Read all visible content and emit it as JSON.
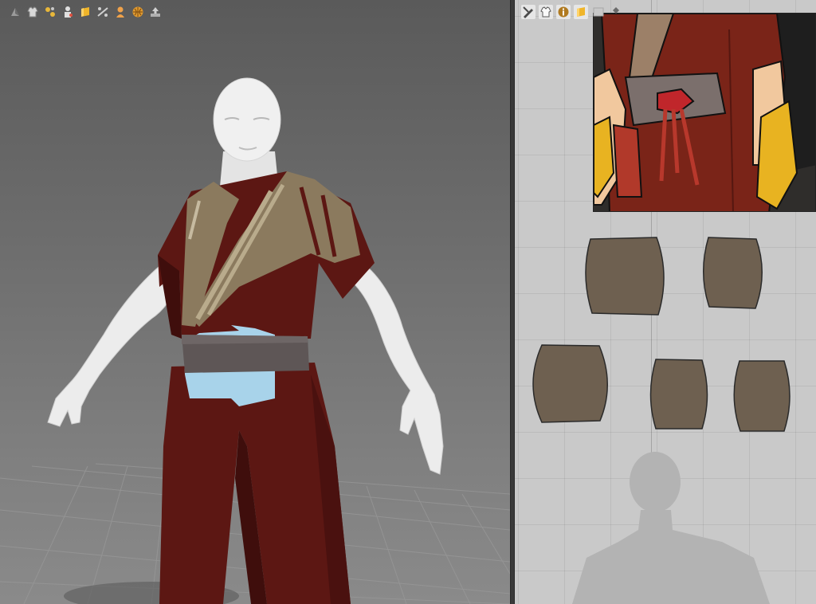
{
  "viewport_toolbar": {
    "buttons": [
      {
        "icon": "avatar-display-icon",
        "color": "#9a9a9a"
      },
      {
        "icon": "garment-display-icon",
        "color": "#d8d8d8"
      },
      {
        "icon": "pins-display-icon",
        "color": "#e8b73a"
      },
      {
        "icon": "avatar-pose-icon",
        "color": "#e0e0e0"
      },
      {
        "icon": "texture-display-icon",
        "color": "#f0b52a"
      },
      {
        "icon": "arrangement-points-icon",
        "color": "#cfcfcf"
      },
      {
        "icon": "skin-display-icon",
        "color": "#f0a24a"
      },
      {
        "icon": "fabric-grid-icon",
        "color": "#e09a30"
      },
      {
        "icon": "export-icon",
        "color": "#b0b0b0"
      }
    ]
  },
  "pattern_toolbar": {
    "buttons": [
      {
        "icon": "edit-pattern-icon",
        "color": "#4a4a4a"
      },
      {
        "icon": "garment-view-icon",
        "color": "#5a5a5a"
      },
      {
        "icon": "info-icon",
        "color": "#b07a20"
      },
      {
        "icon": "texture-view-icon",
        "color": "#f0b52a"
      },
      {
        "icon": "image-view-icon",
        "color": "#a8a8a8"
      },
      {
        "icon": "pin-view-icon",
        "color": "#6a6a6a"
      }
    ]
  },
  "colors": {
    "robe": "#5c1713",
    "robe_shadow": "#3f0e0c",
    "collar": "#8b7a5e",
    "collar_stripe": "#b9ab8c",
    "belt": "#5e5656",
    "sash": "#a8d3ea",
    "skin": "#ececec",
    "pattern_fill": "#6e6050",
    "pattern_panel_bg": "#c9c9c9"
  },
  "pattern_pieces": [
    {
      "name": "pattern-piece-1"
    },
    {
      "name": "pattern-piece-2"
    },
    {
      "name": "pattern-piece-3"
    },
    {
      "name": "pattern-piece-4"
    },
    {
      "name": "pattern-piece-5"
    }
  ]
}
